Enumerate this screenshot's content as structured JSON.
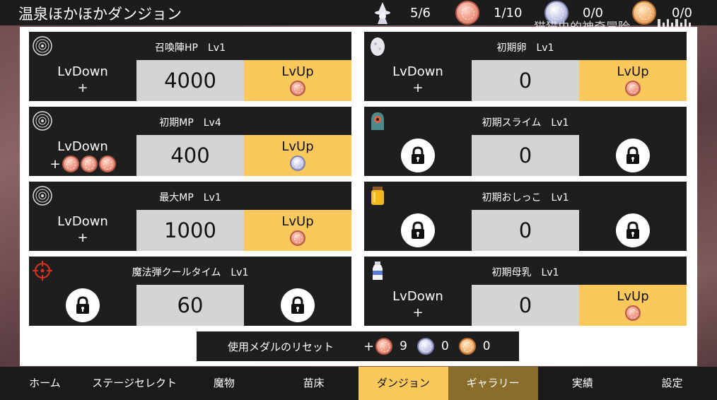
{
  "header": {
    "title": "温泉ほかほかダンジョン",
    "counters": [
      {
        "icon": "witch-icon",
        "value": "5/6"
      },
      {
        "icon": "red-medal-icon",
        "value": "1/10"
      },
      {
        "icon": "silver-medal-icon",
        "value": "0/0"
      },
      {
        "icon": "gold-medal-icon",
        "value": "0/0"
      }
    ],
    "watermark": "猫猫虫的神奇冒险",
    "watermark_logo": "bilibili"
  },
  "cards": [
    {
      "name": "召喚陣HP　Lv1",
      "icon": "magic-circle-icon",
      "down": "LvDown",
      "plus": "+",
      "value": "4000",
      "up": "LvUp",
      "up_medal": "red",
      "plus_medals": []
    },
    {
      "name": "初期卵　Lv1",
      "icon": "egg-icon",
      "down": "LvDown",
      "plus": "+",
      "value": "0",
      "up": "LvUp",
      "up_medal": "red",
      "plus_medals": []
    },
    {
      "name": "初期MP　Lv4",
      "icon": "magic-circle-icon",
      "down": "LvDown",
      "plus": "+",
      "value": "400",
      "up": "LvUp",
      "up_medal": "silver",
      "plus_medals": [
        "red",
        "red",
        "red"
      ]
    },
    {
      "name": "初期スライム　Lv1",
      "icon": "slime-icon",
      "value": "0",
      "locked": true
    },
    {
      "name": "最大MP　Lv1",
      "icon": "magic-circle-icon",
      "down": "LvDown",
      "plus": "+",
      "value": "1000",
      "up": "LvUp",
      "up_medal": "red",
      "plus_medals": []
    },
    {
      "name": "初期おしっこ　Lv1",
      "icon": "jar-icon",
      "value": "0",
      "locked": true
    },
    {
      "name": "魔法弾クールタイム　Lv1",
      "icon": "crosshair-icon",
      "value": "60",
      "locked": true
    },
    {
      "name": "初期母乳　Lv1",
      "icon": "milk-bottle-icon",
      "down": "LvDown",
      "plus": "+",
      "value": "0",
      "up": "LvUp",
      "up_medal": "red",
      "plus_medals": []
    }
  ],
  "reset": {
    "label": "使用メダルのリセット",
    "plus": "+",
    "red_count": "9",
    "silver_count": "0",
    "gold_count": "0"
  },
  "nav": [
    {
      "label": "ホーム",
      "state": "normal"
    },
    {
      "label": "ステージセレクト",
      "state": "normal"
    },
    {
      "label": "魔物",
      "state": "normal"
    },
    {
      "label": "苗床",
      "state": "normal"
    },
    {
      "label": "ダンジョン",
      "state": "active"
    },
    {
      "label": "ギャラリー",
      "state": "hover"
    },
    {
      "label": "実績",
      "state": "normal"
    },
    {
      "label": "設定",
      "state": "normal"
    }
  ],
  "colors": {
    "accent": "#fbc85b",
    "hover": "#8a6d2a",
    "card_bg": "#1e1e1e",
    "value_bg": "#d4d4d4"
  }
}
